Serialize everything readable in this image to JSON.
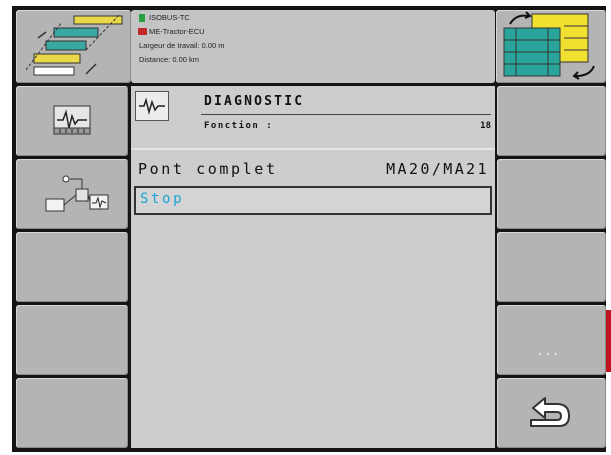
{
  "header": {
    "info_lines": [
      "ISOBUS-TC",
      "ME-Tractor-ECU",
      "Largeur de travail: 0.00 m",
      "Distance: 0.00 km"
    ],
    "left_icon": "field-section-map-icon",
    "right_icon": "section-swap-icon"
  },
  "left_softkeys": [
    {
      "icon": "oscilloscope-icon"
    },
    {
      "icon": "sensor-diagnostic-icon"
    },
    {
      "icon": ""
    },
    {
      "icon": ""
    },
    {
      "icon": ""
    }
  ],
  "right_softkeys": [
    {
      "label": ""
    },
    {
      "label": ""
    },
    {
      "label": ""
    },
    {
      "label": "...",
      "icon": "more-icon"
    },
    {
      "label": "",
      "icon": "back-arrow-icon"
    }
  ],
  "diagnostic": {
    "icon": "waveform-icon",
    "title": "DIAGNOSTIC",
    "function_label": "Fonction :",
    "function_value": "18",
    "item_label": "Pont complet",
    "item_value": "MA20/MA21",
    "state_value": "Stop"
  },
  "colors": {
    "panel_bg": "#cdcdcd",
    "button_bg": "#b4b4b4",
    "frame": "#141414",
    "state_text": "#1aa3d8",
    "red_edge": "#c0141e"
  }
}
